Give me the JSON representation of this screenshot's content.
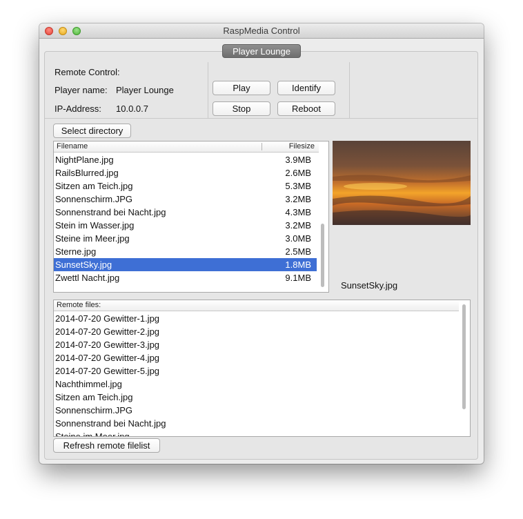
{
  "window": {
    "title": "RaspMedia Control"
  },
  "tab": {
    "label": "Player Lounge"
  },
  "info": {
    "remote_control_label": "Remote Control:",
    "player_name_label": "Player name:",
    "player_name_value": "Player Lounge",
    "ip_label": "IP-Address:",
    "ip_value": "10.0.0.7"
  },
  "controls": {
    "play": "Play",
    "identify": "Identify",
    "stop": "Stop",
    "reboot": "Reboot"
  },
  "select_directory": "Select directory",
  "local_files": {
    "col_filename": "Filename",
    "col_filesize": "Filesize",
    "rows": [
      {
        "name": "NightPlane.jpg",
        "size": "3.9MB"
      },
      {
        "name": "RailsBlurred.jpg",
        "size": "2.6MB"
      },
      {
        "name": "Sitzen am Teich.jpg",
        "size": "5.3MB"
      },
      {
        "name": "Sonnenschirm.JPG",
        "size": "3.2MB"
      },
      {
        "name": "Sonnenstrand bei Nacht.jpg",
        "size": "4.3MB"
      },
      {
        "name": "Stein im Wasser.jpg",
        "size": "3.2MB"
      },
      {
        "name": "Steine im Meer.jpg",
        "size": "3.0MB"
      },
      {
        "name": "Sterne.jpg",
        "size": "2.5MB"
      },
      {
        "name": "SunsetSky.jpg",
        "size": "1.8MB",
        "selected": true
      },
      {
        "name": "Zwettl Nacht.jpg",
        "size": "9.1MB"
      }
    ]
  },
  "preview": {
    "caption": "SunsetSky.jpg"
  },
  "remote_files": {
    "header": "Remote files:",
    "rows": [
      "2014-07-20 Gewitter-1.jpg",
      "2014-07-20 Gewitter-2.jpg",
      "2014-07-20 Gewitter-3.jpg",
      "2014-07-20 Gewitter-4.jpg",
      "2014-07-20 Gewitter-5.jpg",
      "Nachthimmel.jpg",
      "Sitzen am Teich.jpg",
      "Sonnenschirm.JPG",
      "Sonnenstrand bei Nacht.jpg",
      "Steine im Meer.jpg"
    ]
  },
  "refresh_button": "Refresh remote filelist",
  "colors": {
    "selection": "#3e6fd5",
    "tab": "#7d7d7d",
    "window_bg": "#ececec"
  }
}
